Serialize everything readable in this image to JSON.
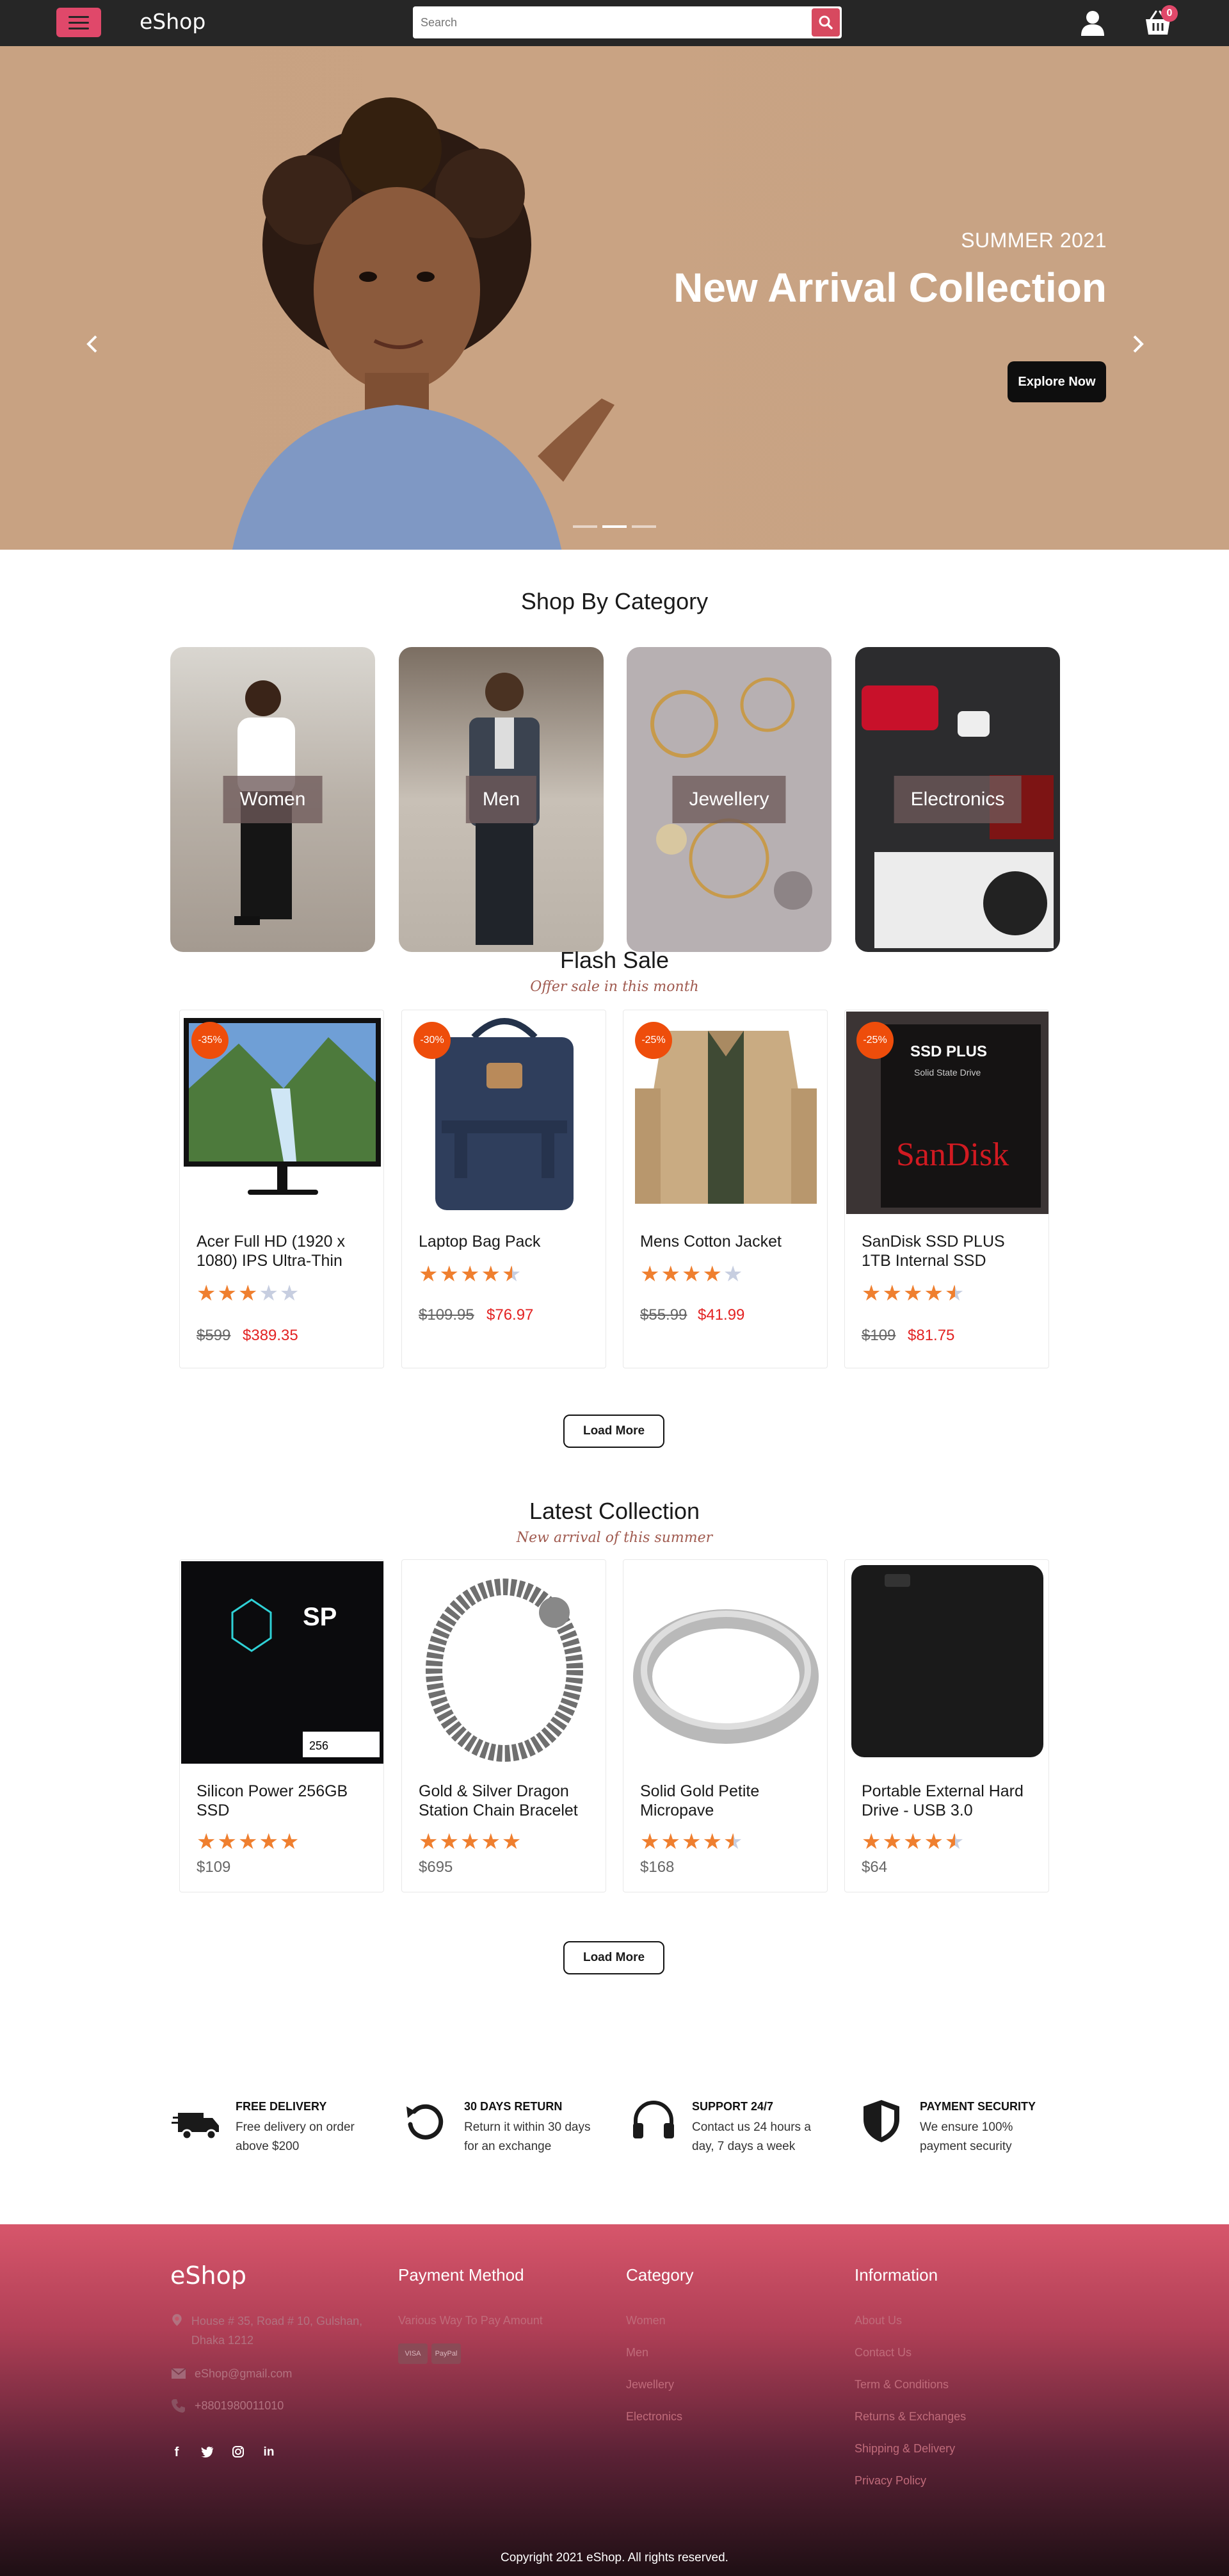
{
  "header": {
    "brand": "eShop",
    "search_placeholder": "Search",
    "cart_count": "0",
    "accent": "#e0486a"
  },
  "hero": {
    "subtitle": "SUMMER 2021",
    "title": "New Arrival Collection",
    "cta": "Explore Now",
    "slides": 3,
    "active_slide": 1
  },
  "categories": {
    "title": "Shop By Category",
    "items": [
      {
        "label": "Women"
      },
      {
        "label": "Men"
      },
      {
        "label": "Jewellery"
      },
      {
        "label": "Electronics"
      }
    ]
  },
  "flash_sale": {
    "title": "Flash Sale",
    "subtitle": "Offer sale in this month",
    "load_more": "Load More",
    "products": [
      {
        "discount": "-35%",
        "name": "Acer Full HD (1920 x 1080) IPS Ultra-Thin",
        "rating": 3,
        "old_price": "$599",
        "price": "$389.35"
      },
      {
        "discount": "-30%",
        "name": "Laptop Bag Pack",
        "rating": 4.5,
        "old_price": "$109.95",
        "price": "$76.97"
      },
      {
        "discount": "-25%",
        "name": "Mens Cotton Jacket",
        "rating": 4,
        "old_price": "$55.99",
        "price": "$41.99"
      },
      {
        "discount": "-25%",
        "name": "SanDisk SSD PLUS 1TB Internal SSD",
        "rating": 4.5,
        "old_price": "$109",
        "price": "$81.75"
      }
    ]
  },
  "latest": {
    "title": "Latest Collection",
    "subtitle": "New arrival of this summer",
    "load_more": "Load More",
    "products": [
      {
        "name": "Silicon Power 256GB SSD",
        "rating": 5,
        "price": "$109"
      },
      {
        "name": "Gold & Silver Dragon Station Chain Bracelet",
        "rating": 5,
        "price": "$695"
      },
      {
        "name": "Solid Gold Petite Micropave",
        "rating": 4.5,
        "price": "$168"
      },
      {
        "name": "Portable External Hard Drive - USB 3.0",
        "rating": 4.5,
        "price": "$64"
      }
    ]
  },
  "services": [
    {
      "icon": "truck-icon",
      "title": "FREE DELIVERY",
      "desc": "Free delivery on order above $200"
    },
    {
      "icon": "return-icon",
      "title": "30 DAYS RETURN",
      "desc": "Return it within 30 days for an exchange"
    },
    {
      "icon": "headphones-icon",
      "title": "SUPPORT 24/7",
      "desc": "Contact us 24 hours a day, 7 days a week"
    },
    {
      "icon": "shield-icon",
      "title": "PAYMENT SECURITY",
      "desc": "We ensure 100% payment security"
    }
  ],
  "footer": {
    "brand": "eShop",
    "address": "House # 35, Road # 10, Gulshan, Dhaka 1212",
    "email": "eShop@gmail.com",
    "phone": "+8801980011010",
    "payment_title": "Payment Method",
    "payment_text": "Various Way To Pay Amount",
    "payment_cards": [
      "VISA",
      "PayPal"
    ],
    "category_title": "Category",
    "category_links": [
      "Women",
      "Men",
      "Jewellery",
      "Electronics"
    ],
    "info_title": "Information",
    "info_links": [
      "About Us",
      "Contact Us",
      "Term & Conditions",
      "Returns & Exchanges",
      "Shipping & Delivery",
      "Privacy Policy"
    ],
    "copyright": "Copyright 2021 eShop. All rights reserved."
  }
}
